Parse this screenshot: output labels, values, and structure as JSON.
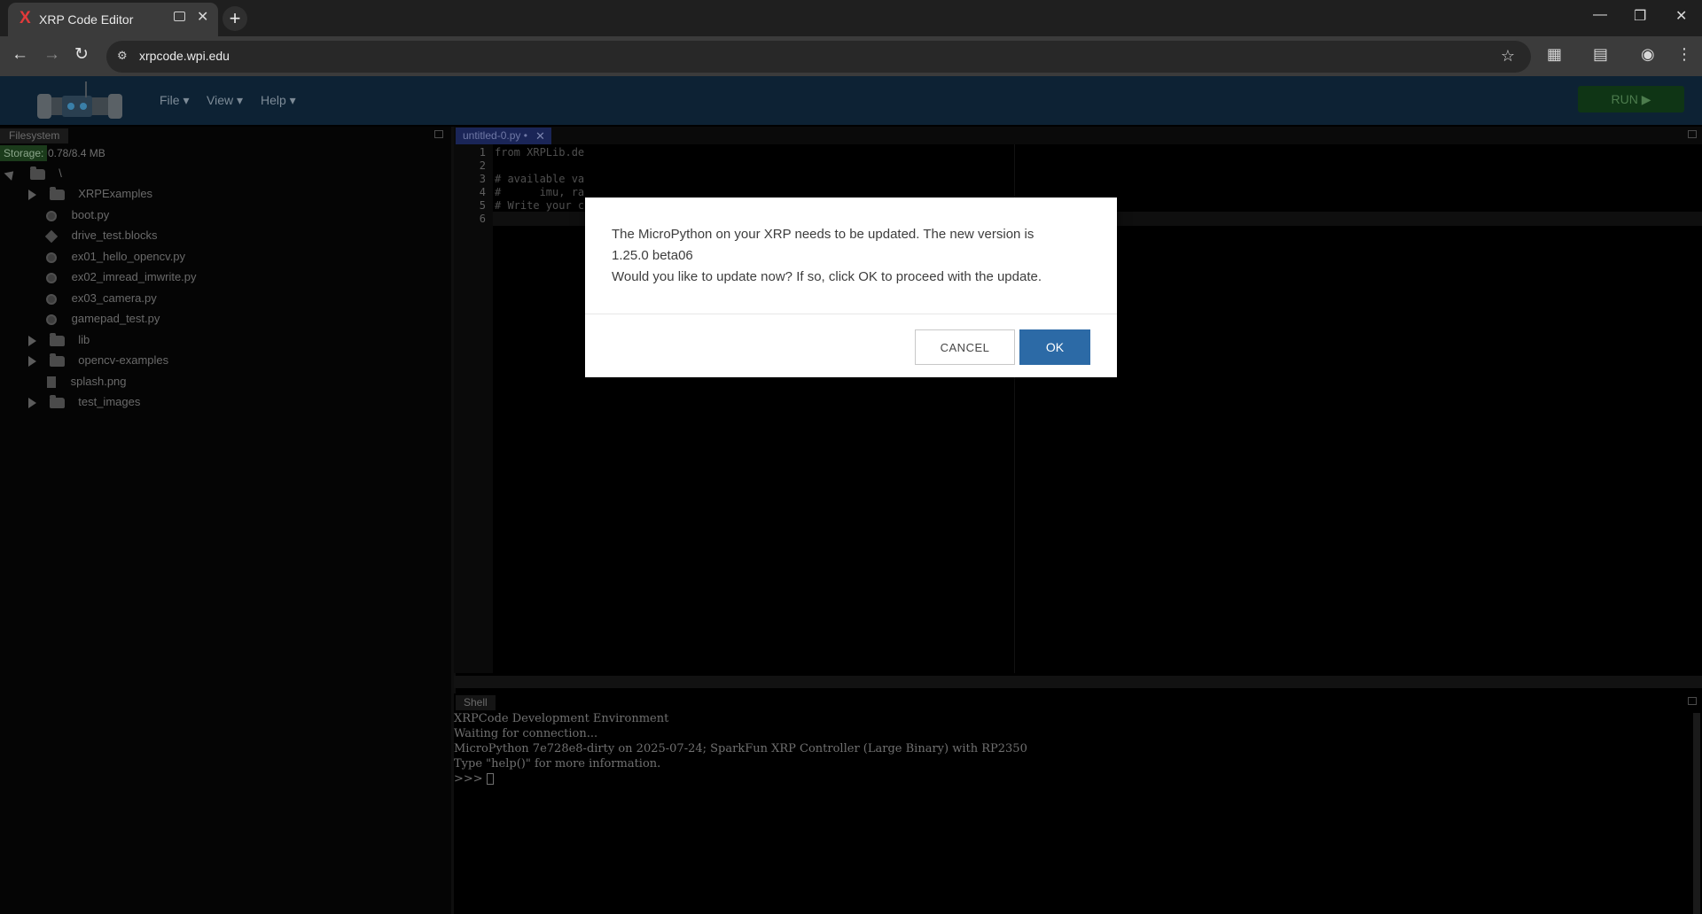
{
  "browser": {
    "tab_title": "XRP Code Editor",
    "tab_favicon": "X",
    "tab_close": "✕",
    "new_tab": "+",
    "url": "xrpcode.wpi.edu",
    "icons": [
      "back-arrow-icon",
      "forward-arrow-icon",
      "reload-icon",
      "site-info-icon",
      "star-icon",
      "extensions-icon",
      "cast-icon",
      "profile-icon",
      "menu-dots-icon"
    ],
    "window_controls": {
      "minimize": "—",
      "restore": "❐",
      "close": "✕"
    }
  },
  "app": {
    "menu": {
      "file": "File ▾",
      "view": "View ▾",
      "help": "Help ▾"
    },
    "run_label": "RUN ▶"
  },
  "filesystem": {
    "tab_label": "Filesystem",
    "storage_label": "Storage:",
    "storage_value": "0.78/8.4 MB",
    "root": "\\",
    "items": [
      {
        "name": "XRPExamples",
        "type": "folder"
      },
      {
        "name": "boot.py",
        "type": "py"
      },
      {
        "name": "drive_test.blocks",
        "type": "blocks"
      },
      {
        "name": "ex01_hello_opencv.py",
        "type": "py"
      },
      {
        "name": "ex02_imread_imwrite.py",
        "type": "py"
      },
      {
        "name": "ex03_camera.py",
        "type": "py"
      },
      {
        "name": "gamepad_test.py",
        "type": "py"
      },
      {
        "name": "lib",
        "type": "folder"
      },
      {
        "name": "opencv-examples",
        "type": "folder"
      },
      {
        "name": "splash.png",
        "type": "file"
      },
      {
        "name": "test_images",
        "type": "folder"
      }
    ]
  },
  "editor": {
    "tab_label": "untitled-0.py •",
    "tab_close": "✕",
    "line_numbers": [
      "1",
      "2",
      "3",
      "4",
      "5",
      "6"
    ],
    "lines": [
      "from XRPLib.de",
      "",
      "# available va",
      "#      imu, ra",
      "# Write your c",
      ""
    ]
  },
  "shell": {
    "tab_label": "Shell",
    "lines": [
      "XRPCode Development Environment",
      "Waiting for connection...",
      "MicroPython 7e728e8-dirty on 2025-07-24; SparkFun XRP Controller (Large Binary) with RP2350",
      "Type \"help()\" for more information."
    ],
    "prompt": ">>> "
  },
  "dialog": {
    "line1": "The MicroPython on your XRP needs to be updated. The new version is",
    "line2": "1.25.0 beta06",
    "line3": "Would you like to update now? If so, click OK to proceed with the update.",
    "cancel_label": "CANCEL",
    "ok_label": "OK"
  }
}
